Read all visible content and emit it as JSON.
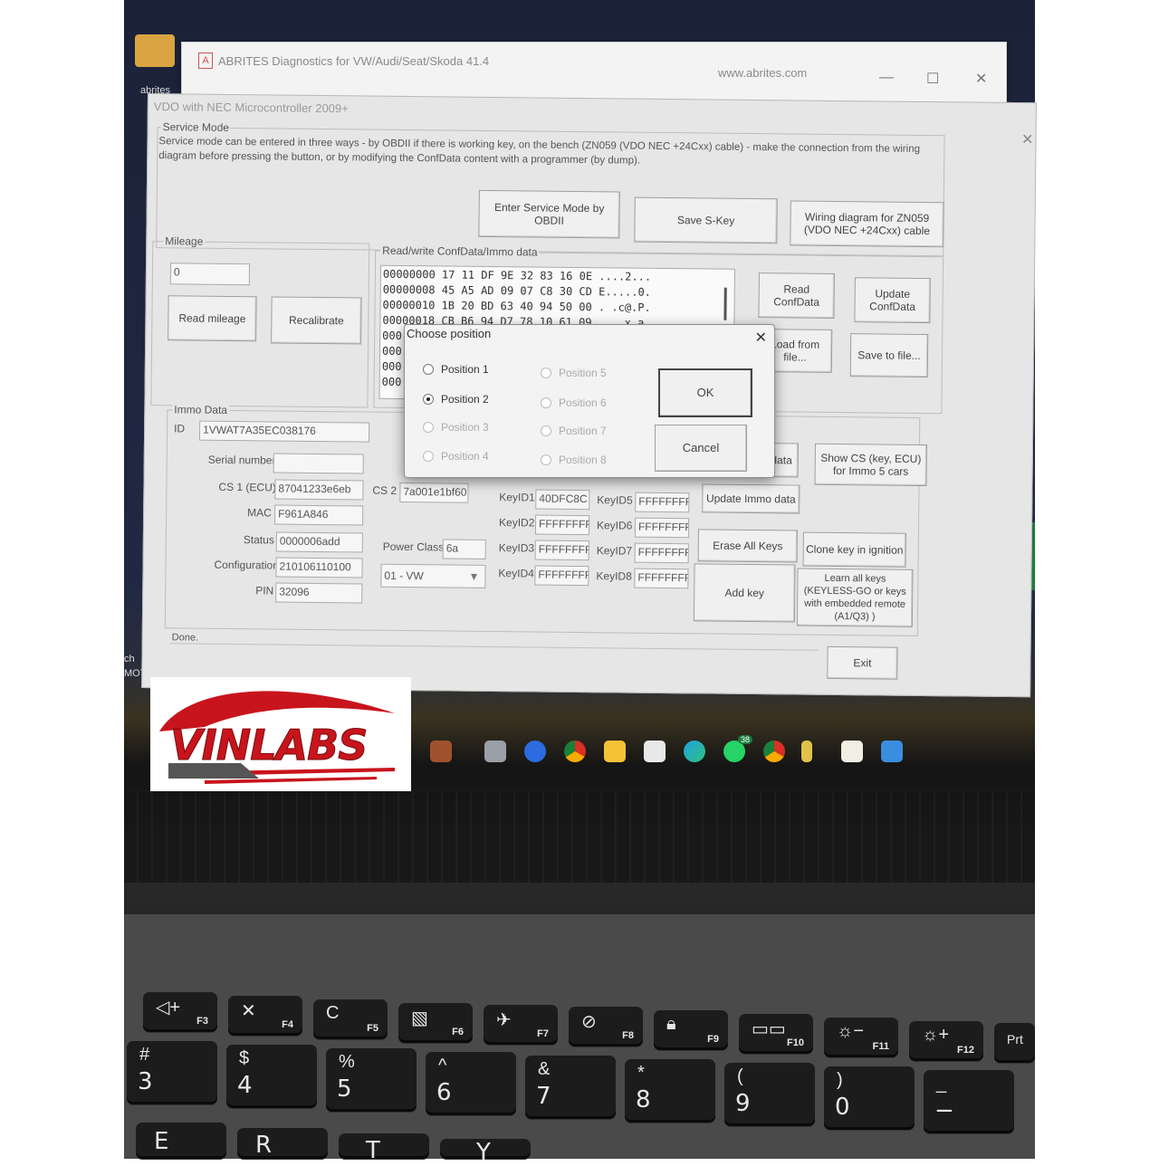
{
  "app_window": {
    "title": "ABRITES Diagnostics for VW/Audi/Seat/Skoda 41.4",
    "url": "www.abrites.com",
    "min": "—",
    "max": "☐",
    "close": "✕"
  },
  "window": {
    "title": "VDO with NEC Microcontroller 2009+",
    "close": "✕",
    "service_mode": {
      "label": "Service Mode",
      "description_line1": "Service mode can be entered in three ways - by OBDII if there is working key, on the bench (ZN059 (VDO NEC +24Cxx) cable) - make the connection from the wiring",
      "description_line2": "diagram before pressing the button, or by modifying the ConfData content with a programmer (by dump).",
      "enter_button": "Enter Service Mode by OBDII",
      "save_skey_button": "Save S-Key",
      "wiring_button": "Wiring diagram for ZN059 (VDO NEC +24Cxx) cable"
    },
    "mileage": {
      "label": "Mileage",
      "value": "0",
      "read_button": "Read mileage",
      "recalibrate_button": "Recalibrate"
    },
    "confdata": {
      "label": "Read/write ConfData/Immo data",
      "lines": [
        "00000000 17 11 DF 9E 32 83 16 0E ....2...",
        "00000008 45 A5 AD 09 07 C8 30 CD E.....0.",
        "00000010 1B 20 BD 63 40 94 50 00 . .c@.P.",
        "00000018 CB B6 94 D7 78 10 61 09 ....x.a."
      ],
      "partial_prefix": "000",
      "read_button": "Read ConfData",
      "update_button": "Update ConfData",
      "load_button": "Load from file...",
      "save_button": "Save to file..."
    },
    "immo": {
      "label": "Immo Data",
      "id_label": "ID",
      "id_value": "1VWAT7A35EC038176",
      "serial_label": "Serial number",
      "serial_value": "",
      "cs1_label": "CS 1 (ECU)",
      "cs1_value": "87041233e6eb",
      "cs2_label": "CS 2",
      "cs2_value": "7a001e1bf601",
      "mac_label": "MAC",
      "mac_value": "F961A846",
      "status_label": "Status",
      "status_value": "0000006add",
      "config_label": "Configuration",
      "config_value": "210106110100",
      "pin_label": "PIN",
      "pin_value": "32096",
      "power_class_label": "Power Class",
      "power_class_value": "6a",
      "brand_select": "01 - VW",
      "keys": [
        {
          "label": "KeyID1",
          "value": "40DFC8C"
        },
        {
          "label": "KeyID2",
          "value": "FFFFFFFF"
        },
        {
          "label": "KeyID3",
          "value": "FFFFFFFF"
        },
        {
          "label": "KeyID4",
          "value": "FFFFFFFF"
        },
        {
          "label": "KeyID5",
          "value": "FFFFFFFF"
        },
        {
          "label": "KeyID6",
          "value": "FFFFFFFF"
        },
        {
          "label": "KeyID7",
          "value": "FFFFFFFF"
        },
        {
          "label": "KeyID8",
          "value": "FFFFFFFF"
        }
      ],
      "read_immo_button_partial": "o data",
      "show_cs_button": "Show CS (key, ECU) for Immo 5 cars",
      "update_immo_button": "Update Immo data",
      "erase_keys_button": "Erase All Keys",
      "clone_key_button": "Clone key in ignition",
      "add_key_button": "Add key",
      "learn_keys_button": "Learn all keys (KEYLESS-GO or keys with embedded remote (A1/Q3) )"
    },
    "status_text": "Done.",
    "exit_button": "Exit"
  },
  "dialog": {
    "title": "Choose position",
    "close": "✕",
    "positions": [
      {
        "label": "Position 1",
        "selected": false,
        "enabled": true
      },
      {
        "label": "Position 2",
        "selected": true,
        "enabled": true
      },
      {
        "label": "Position 3",
        "selected": false,
        "enabled": false
      },
      {
        "label": "Position 4",
        "selected": false,
        "enabled": false
      },
      {
        "label": "Position 5",
        "selected": false,
        "enabled": false
      },
      {
        "label": "Position 6",
        "selected": false,
        "enabled": false
      },
      {
        "label": "Position 7",
        "selected": false,
        "enabled": false
      },
      {
        "label": "Position 8",
        "selected": false,
        "enabled": false
      }
    ],
    "ok": "OK",
    "cancel": "Cancel"
  },
  "desktop": {
    "icon_text_1": "abrites",
    "icon_text_2": "ch",
    "icon_text_3": "MOT"
  },
  "taskbar": {
    "whatsapp_badge": "38"
  },
  "watermark": {
    "text": "VINLABS"
  },
  "keyboard": {
    "fn_row": [
      {
        "glyph": "◁+",
        "label": "F3"
      },
      {
        "glyph": "✕",
        "label": "F4"
      },
      {
        "glyph": "C",
        "label": "F5"
      },
      {
        "glyph": "▧",
        "label": "F6"
      },
      {
        "glyph": "✈",
        "label": "F7"
      },
      {
        "glyph": "⊘",
        "label": "F8"
      },
      {
        "glyph": "🔒︎",
        "label": "F9"
      },
      {
        "glyph": "▭▭",
        "label": "F10"
      },
      {
        "glyph": "☼−",
        "label": "F11"
      },
      {
        "glyph": "☼+",
        "label": "F12"
      },
      {
        "glyph": "",
        "label": "Prt"
      }
    ],
    "num_row": [
      {
        "top": "#",
        "main": "3"
      },
      {
        "top": "$",
        "main": "4"
      },
      {
        "top": "%",
        "main": "5"
      },
      {
        "top": "^",
        "main": "6"
      },
      {
        "top": "&",
        "main": "7"
      },
      {
        "top": "*",
        "main": "8"
      },
      {
        "top": "(",
        "main": "9"
      },
      {
        "top": ")",
        "main": "0"
      },
      {
        "top": "_",
        "main": "−"
      }
    ],
    "letter_row": [
      "E",
      "R",
      "T",
      "Y"
    ]
  }
}
